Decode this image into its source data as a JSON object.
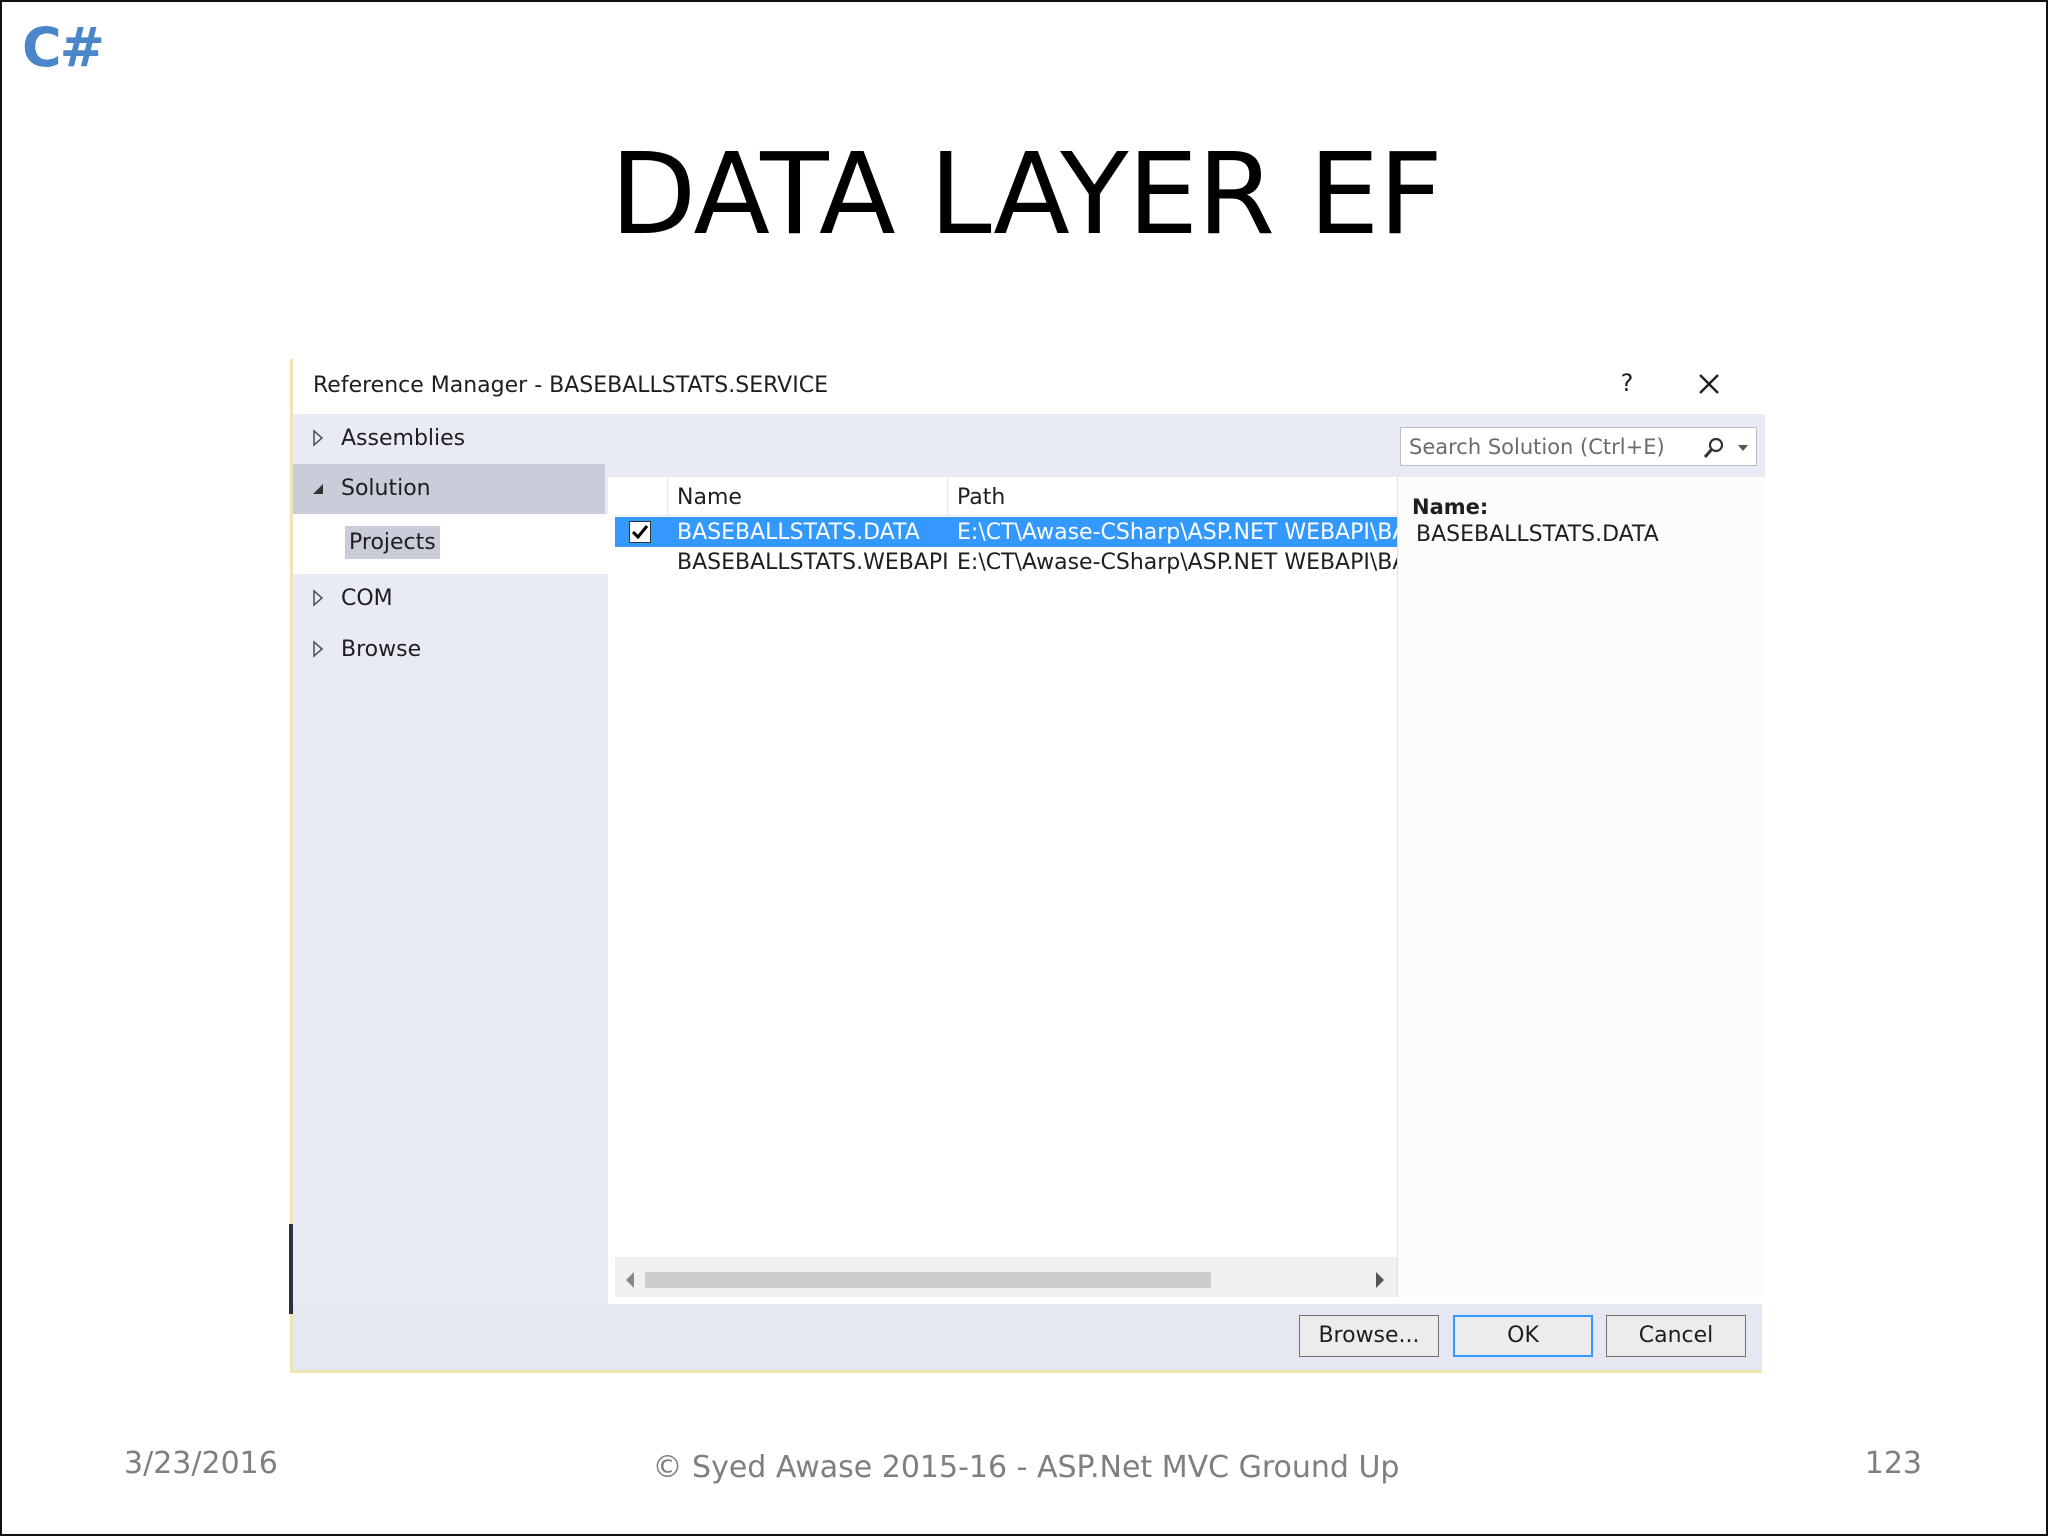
{
  "slide": {
    "logo": "C#",
    "title": "DATA LAYER EF",
    "footer_date": "3/23/2016",
    "footer_copyright": "© Syed Awase 2015-16 - ASP.Net MVC Ground Up",
    "page_number": "123"
  },
  "dialog": {
    "title": "Reference Manager - BASEBALLSTATS.SERVICE",
    "help_label": "?",
    "sidebar": {
      "assemblies": "Assemblies",
      "solution": "Solution",
      "projects": "Projects",
      "com": "COM",
      "browse": "Browse"
    },
    "search_placeholder": "Search Solution (Ctrl+E)",
    "columns": {
      "name": "Name",
      "path": "Path"
    },
    "rows": [
      {
        "checked": true,
        "selected": true,
        "name": "BASEBALLSTATS.DATA",
        "path": "E:\\CT\\Awase-CSharp\\ASP.NET WEBAPI\\BAS"
      },
      {
        "checked": false,
        "selected": false,
        "name": "BASEBALLSTATS.WEBAPI",
        "path": "E:\\CT\\Awase-CSharp\\ASP.NET WEBAPI\\BAS"
      }
    ],
    "detail": {
      "label": "Name:",
      "value": "BASEBALLSTATS.DATA"
    },
    "buttons": {
      "browse": "Browse...",
      "ok": "OK",
      "cancel": "Cancel"
    }
  },
  "colors": {
    "logo": "#4a86c8",
    "selection": "#3399ff",
    "sidebar_bg": "#e8ebf5"
  }
}
